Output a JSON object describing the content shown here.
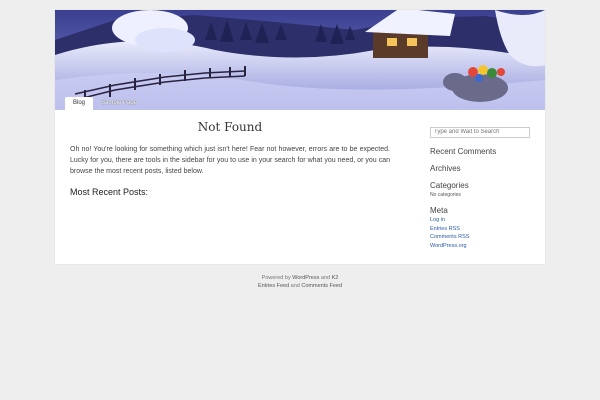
{
  "header": {
    "image": "winter-cabin-header",
    "nav": [
      {
        "label": "Blog",
        "active": true
      },
      {
        "label": "Sample Page",
        "active": false
      }
    ]
  },
  "main": {
    "title": "Not Found",
    "message": "Oh no! You're looking for something which just isn't here! Fear not however, errors are to be expected. Lucky for you, there are tools in the sidebar for you to use in your search for what you need, or you can browse the most recent posts, listed below.",
    "recent_heading": "Most Recent Posts:"
  },
  "sidebar": {
    "search_placeholder": "Type and Wait to Search",
    "recent_comments": "Recent Comments",
    "archives": "Archives",
    "categories": "Categories",
    "no_categories": "No categories",
    "meta": "Meta",
    "meta_links": [
      "Log in",
      "Entries RSS",
      "Comments RSS",
      "WordPress.org"
    ]
  },
  "footer": {
    "powered_prefix": "Powered by",
    "wordpress": "WordPress",
    "and": "and",
    "k2": "K2",
    "entries_feed": "Entries Feed",
    "and2": "and",
    "comments_feed": "Comments Feed"
  },
  "colors": {
    "page_bg": "#eeeeee",
    "link": "#2b5aa8"
  }
}
